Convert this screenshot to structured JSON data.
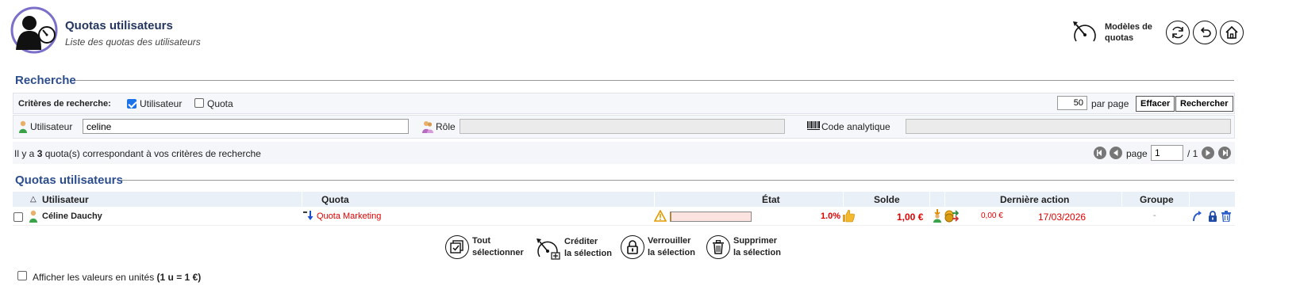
{
  "header": {
    "title": "Quotas utilisateurs",
    "subtitle": "Liste des quotas des utilisateurs",
    "models_label_1": "Modèles de",
    "models_label_2": "quotas",
    "accent_color": "#7a6fc9"
  },
  "search": {
    "title": "Recherche",
    "criteria_label": "Critères de recherche:",
    "criteria": [
      {
        "label": "Utilisateur",
        "checked": true
      },
      {
        "label": "Quota",
        "checked": false
      }
    ],
    "per_page_value": "50",
    "per_page_label": "par page",
    "clear_label": "Effacer",
    "search_label": "Rechercher",
    "user_label": "Utilisateur",
    "user_value": "celine",
    "role_label": "Rôle",
    "role_value": "",
    "analytic_label": "Code analytique",
    "analytic_value": ""
  },
  "results": {
    "prefix": "Il y a",
    "count": "3",
    "suffix": "quota(s) correspondant à vos critères de recherche",
    "page_label": "page",
    "page_value": "1",
    "page_total": "/ 1"
  },
  "table": {
    "title": "Quotas utilisateurs",
    "sort_indicator": "△",
    "columns": [
      "Utilisateur",
      "Quota",
      "État",
      "Solde",
      "Dernière action",
      "Groupe"
    ],
    "rows": [
      {
        "user": "Céline Dauchy",
        "quota": "Quota Marketing",
        "percent": "1.0%",
        "percent_value": 0.01,
        "balance": "1,00 €",
        "last_amount": "0,00 €",
        "last_date": "17/03/2026",
        "group": "-"
      }
    ]
  },
  "actions": [
    {
      "line1": "Tout",
      "line2": "sélectionner"
    },
    {
      "line1": "Créditer",
      "line2": "la sélection"
    },
    {
      "line1": "Verrouiller",
      "line2": "la sélection"
    },
    {
      "line1": "Supprimer",
      "line2": "la sélection"
    }
  ],
  "footer": {
    "units_label": "Afficher les valeurs en unités",
    "units_bold": "(1 u = 1 €)"
  }
}
